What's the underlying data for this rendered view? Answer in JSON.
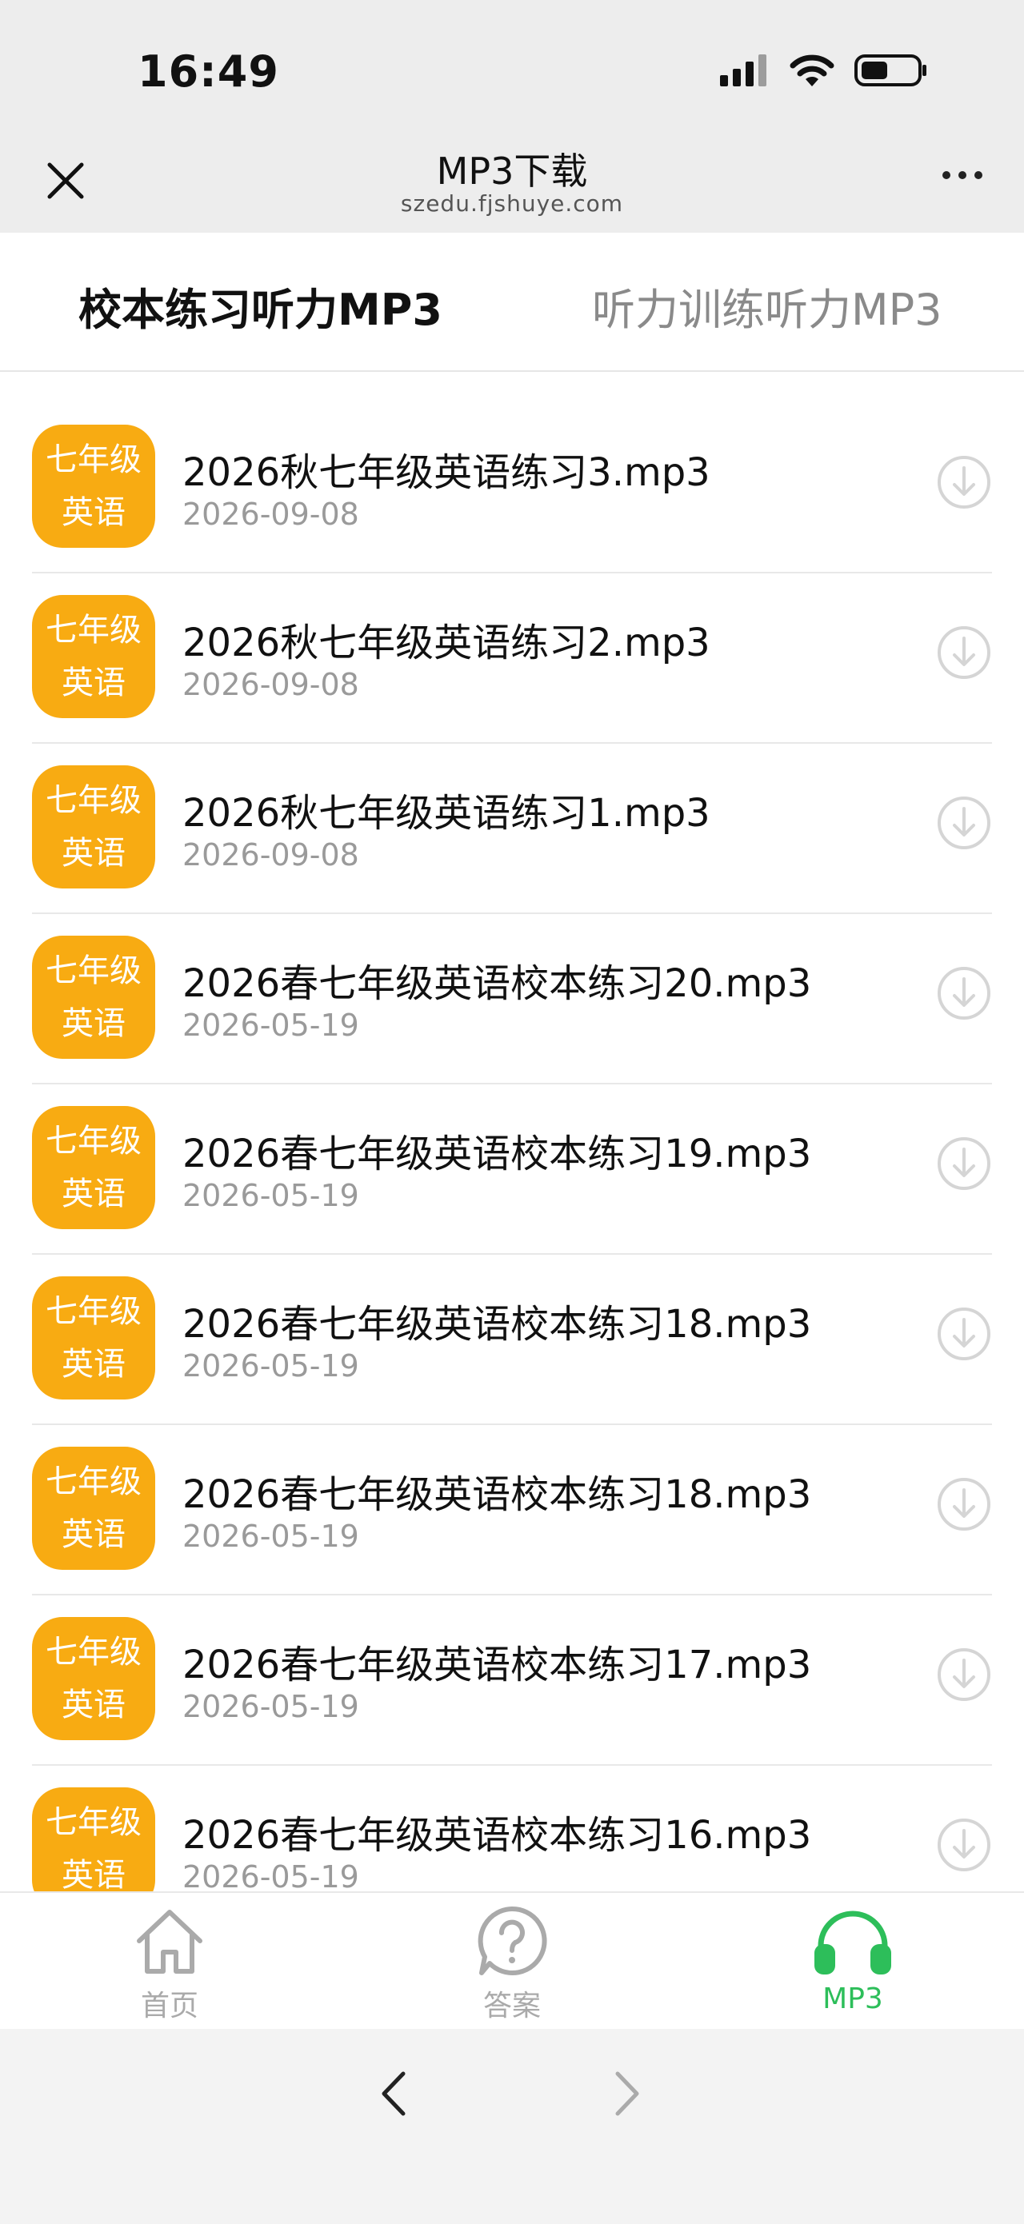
{
  "status_bar": {
    "time": "16:49"
  },
  "nav": {
    "title": "MP3下载",
    "subtitle": "szedu.fjshuye.com"
  },
  "tabs": [
    {
      "label": "校本练习听力MP3",
      "active": true
    },
    {
      "label": "听力训练听力MP3",
      "active": false
    }
  ],
  "files": [
    {
      "badge_top": "七年级",
      "badge_bottom": "英语",
      "name": "2026秋七年级英语练习3.mp3",
      "date": "2026-09-08"
    },
    {
      "badge_top": "七年级",
      "badge_bottom": "英语",
      "name": "2026秋七年级英语练习2.mp3",
      "date": "2026-09-08"
    },
    {
      "badge_top": "七年级",
      "badge_bottom": "英语",
      "name": "2026秋七年级英语练习1.mp3",
      "date": "2026-09-08"
    },
    {
      "badge_top": "七年级",
      "badge_bottom": "英语",
      "name": "2026春七年级英语校本练习20.mp3",
      "date": "2026-05-19"
    },
    {
      "badge_top": "七年级",
      "badge_bottom": "英语",
      "name": "2026春七年级英语校本练习19.mp3",
      "date": "2026-05-19"
    },
    {
      "badge_top": "七年级",
      "badge_bottom": "英语",
      "name": "2026春七年级英语校本练习18.mp3",
      "date": "2026-05-19"
    },
    {
      "badge_top": "七年级",
      "badge_bottom": "英语",
      "name": "2026春七年级英语校本练习18.mp3",
      "date": "2026-05-19"
    },
    {
      "badge_top": "七年级",
      "badge_bottom": "英语",
      "name": "2026春七年级英语校本练习17.mp3",
      "date": "2026-05-19"
    },
    {
      "badge_top": "七年级",
      "badge_bottom": "英语",
      "name": "2026春七年级英语校本练习16.mp3",
      "date": "2026-05-19"
    }
  ],
  "bottom_nav": [
    {
      "label": "首页",
      "icon": "home-icon",
      "active": false
    },
    {
      "label": "答案",
      "icon": "question-icon",
      "active": false
    },
    {
      "label": "MP3",
      "icon": "headphones-icon",
      "active": true
    }
  ],
  "colors": {
    "badge": "#f8ab12",
    "active_green": "#2dbe5a"
  }
}
